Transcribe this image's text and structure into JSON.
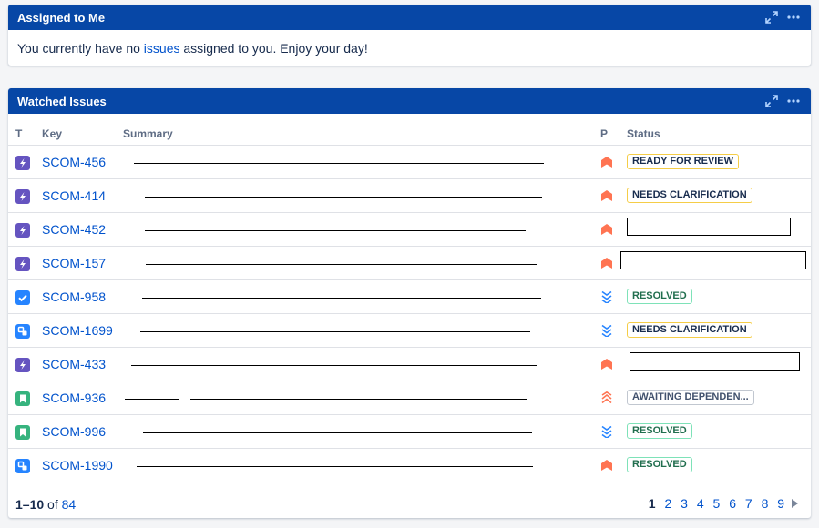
{
  "assigned": {
    "title": "Assigned to Me",
    "msg_before": "You currently have no ",
    "msg_link": "issues",
    "msg_after": " assigned to you. Enjoy your day!"
  },
  "watched": {
    "title": "Watched Issues",
    "columns": {
      "type": "T",
      "key": "Key",
      "summary": "Summary",
      "priority": "P",
      "status": "Status"
    },
    "rows": [
      {
        "type": "epic",
        "key": "SCOM-456",
        "priority": "high",
        "status": "READY FOR REVIEW",
        "status_color": "yellow"
      },
      {
        "type": "epic",
        "key": "SCOM-414",
        "priority": "high",
        "status": "NEEDS CLARIFICATION",
        "status_color": "yellow"
      },
      {
        "type": "epic",
        "key": "SCOM-452",
        "priority": "high",
        "status": "",
        "status_color": "redacted"
      },
      {
        "type": "epic",
        "key": "SCOM-157",
        "priority": "high",
        "status": "",
        "status_color": "redacted"
      },
      {
        "type": "task",
        "key": "SCOM-958",
        "priority": "lowest",
        "status": "RESOLVED",
        "status_color": "green"
      },
      {
        "type": "sub",
        "key": "SCOM-1699",
        "priority": "lowest",
        "status": "NEEDS CLARIFICATION",
        "status_color": "yellow"
      },
      {
        "type": "epic",
        "key": "SCOM-433",
        "priority": "high",
        "status": "",
        "status_color": "redacted"
      },
      {
        "type": "story",
        "key": "SCOM-936",
        "priority": "highest",
        "status": "AWAITING DEPENDEN...",
        "status_color": "gray"
      },
      {
        "type": "story",
        "key": "SCOM-996",
        "priority": "lowest",
        "status": "RESOLVED",
        "status_color": "green"
      },
      {
        "type": "sub",
        "key": "SCOM-1990",
        "priority": "high",
        "status": "RESOLVED",
        "status_color": "green"
      }
    ],
    "footer": {
      "range": "1–10",
      "of": " of ",
      "total": "84"
    },
    "pages": [
      "1",
      "2",
      "3",
      "4",
      "5",
      "6",
      "7",
      "8",
      "9"
    ],
    "current_page": "1",
    "next_icon": "chevron-right-icon"
  },
  "colors": {
    "header": "#0747a6",
    "link": "#0052cc",
    "epic": "#6554c0",
    "task": "#2684ff",
    "story": "#36b37e",
    "high": "#ff7452",
    "lowest": "#2684ff"
  }
}
